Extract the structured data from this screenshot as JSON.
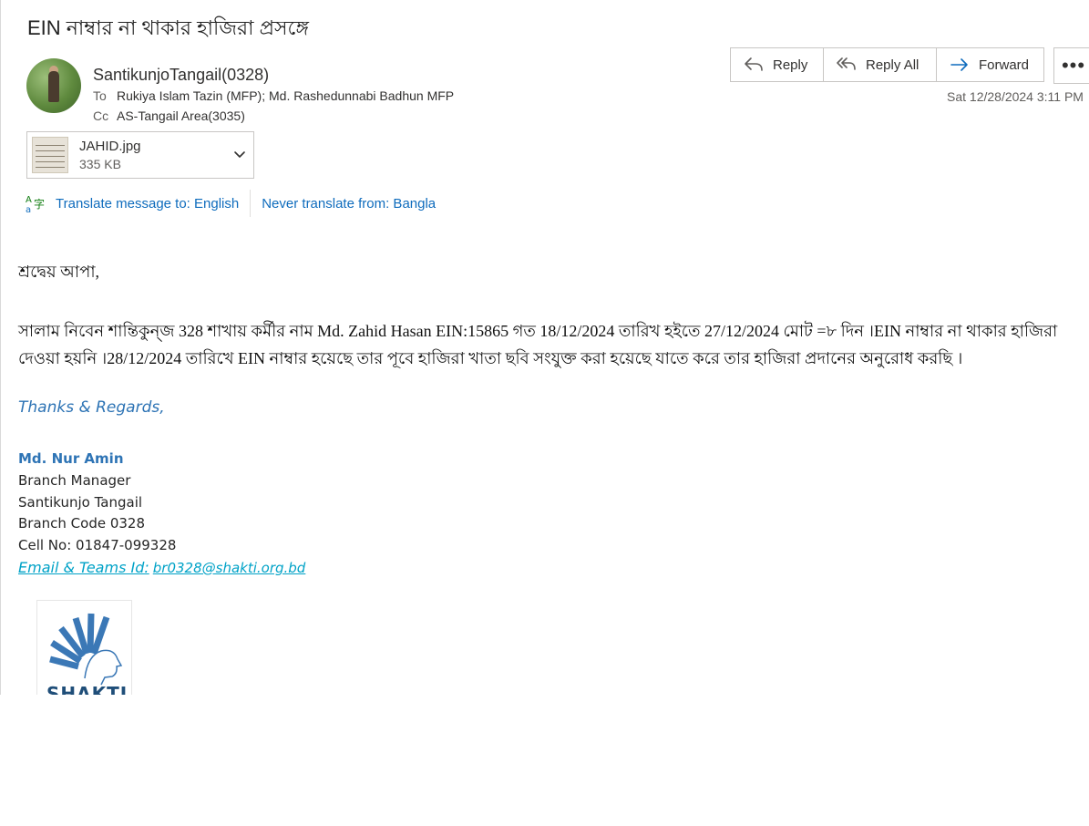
{
  "subject": "EIN নাম্বার না  থাকার হাজিরা প্রসঙ্গে",
  "sender": {
    "name": "SantikunjoTangail(0328)"
  },
  "recipients": {
    "to_label": "To",
    "to": "Rukiya Islam Tazin (MFP); Md. Rashedunnabi Badhun MFP",
    "cc_label": "Cc",
    "cc": "AS-Tangail Area(3035)"
  },
  "actions": {
    "reply": "Reply",
    "reply_all": "Reply All",
    "forward": "Forward",
    "more": "•••"
  },
  "date": "Sat 12/28/2024 3:11 PM",
  "attachment": {
    "name": "JAHID.jpg",
    "size": "335 KB"
  },
  "translate": {
    "icon": "translate-icon",
    "translate_to": "Translate message to: English",
    "never_translate": "Never translate from: Bangla"
  },
  "body": {
    "greeting": "শ্রদ্বেয় আপা,",
    "paragraph": "সালাম নিবেন শান্তিকুন্জ 328 শাখায় কর্মীর নাম Md. Zahid Hasan EIN:15865 গত 18/12/2024 তারিখ হইতে 27/12/2024 মোট =৮ দিন ।EIN নাম্বার না  থাকার হাজিরা দেওয়া হয়নি ।28/12/2024 তারিখে EIN নাম্বার হয়েছে তার পূবে হাজিরা খাতা ছবি সংযুক্ত করা হয়েছে যাতে করে তার হাজিরা প্রদানের অনুরোধ করছি ।"
  },
  "signature": {
    "thanks": "Thanks & Regards,",
    "name": "Md. Nur Amin",
    "title": "Branch Manager",
    "branch": "Santikunjo Tangail",
    "code": "Branch Code 0328",
    "cell": "Cell No: 01847-099328",
    "email_label": "Email & Teams Id:",
    "email": "br0328@shakti.org.bd",
    "logo_text": "SHAKTI"
  },
  "colors": {
    "accent": "#0f6cbd",
    "signature_blue": "#2e74b5",
    "link_cyan": "#00a2c7"
  }
}
